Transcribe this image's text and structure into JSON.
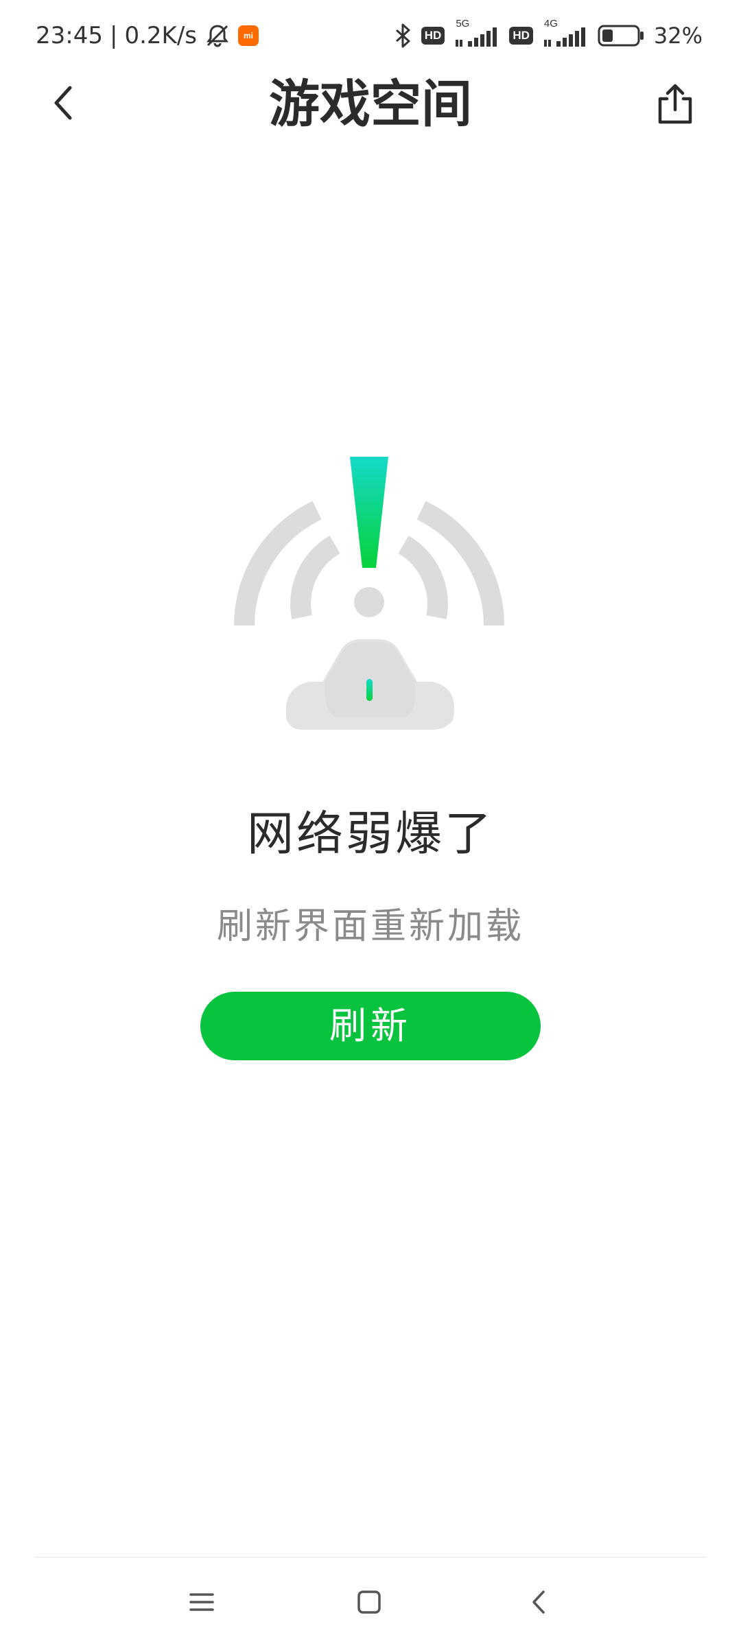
{
  "status_bar": {
    "time": "23:45",
    "network_speed": "0.2K/s",
    "separator": "|",
    "icons": [
      "mute-bell-icon",
      "mi-app-icon",
      "bluetooth-icon",
      "hd-icon",
      "signal-5g-icon",
      "hd-icon",
      "signal-4g-icon",
      "battery-icon"
    ],
    "hd_label": "HD",
    "sim1_generation": "5G",
    "sim2_generation": "4G",
    "battery_percent": "32%",
    "battery_level": 0.32
  },
  "header": {
    "title": "游戏空间",
    "back_icon": "chevron-left-icon",
    "share_icon": "share-icon"
  },
  "error": {
    "illustration_icon": "weak-signal-antenna-icon",
    "title": "网络弱爆了",
    "subtitle": "刷新界面重新加载",
    "refresh_label": "刷新"
  },
  "nav_bar": {
    "icons": [
      "menu-icon",
      "home-icon",
      "back-icon"
    ]
  },
  "colors": {
    "accent": "#07c33d",
    "title_text": "#2b2b2b",
    "subtitle_text": "#8a8a8a",
    "illustration_gray": "#dcdcdc",
    "gradient_top": "#14d9c9",
    "gradient_bottom": "#07d23a"
  }
}
